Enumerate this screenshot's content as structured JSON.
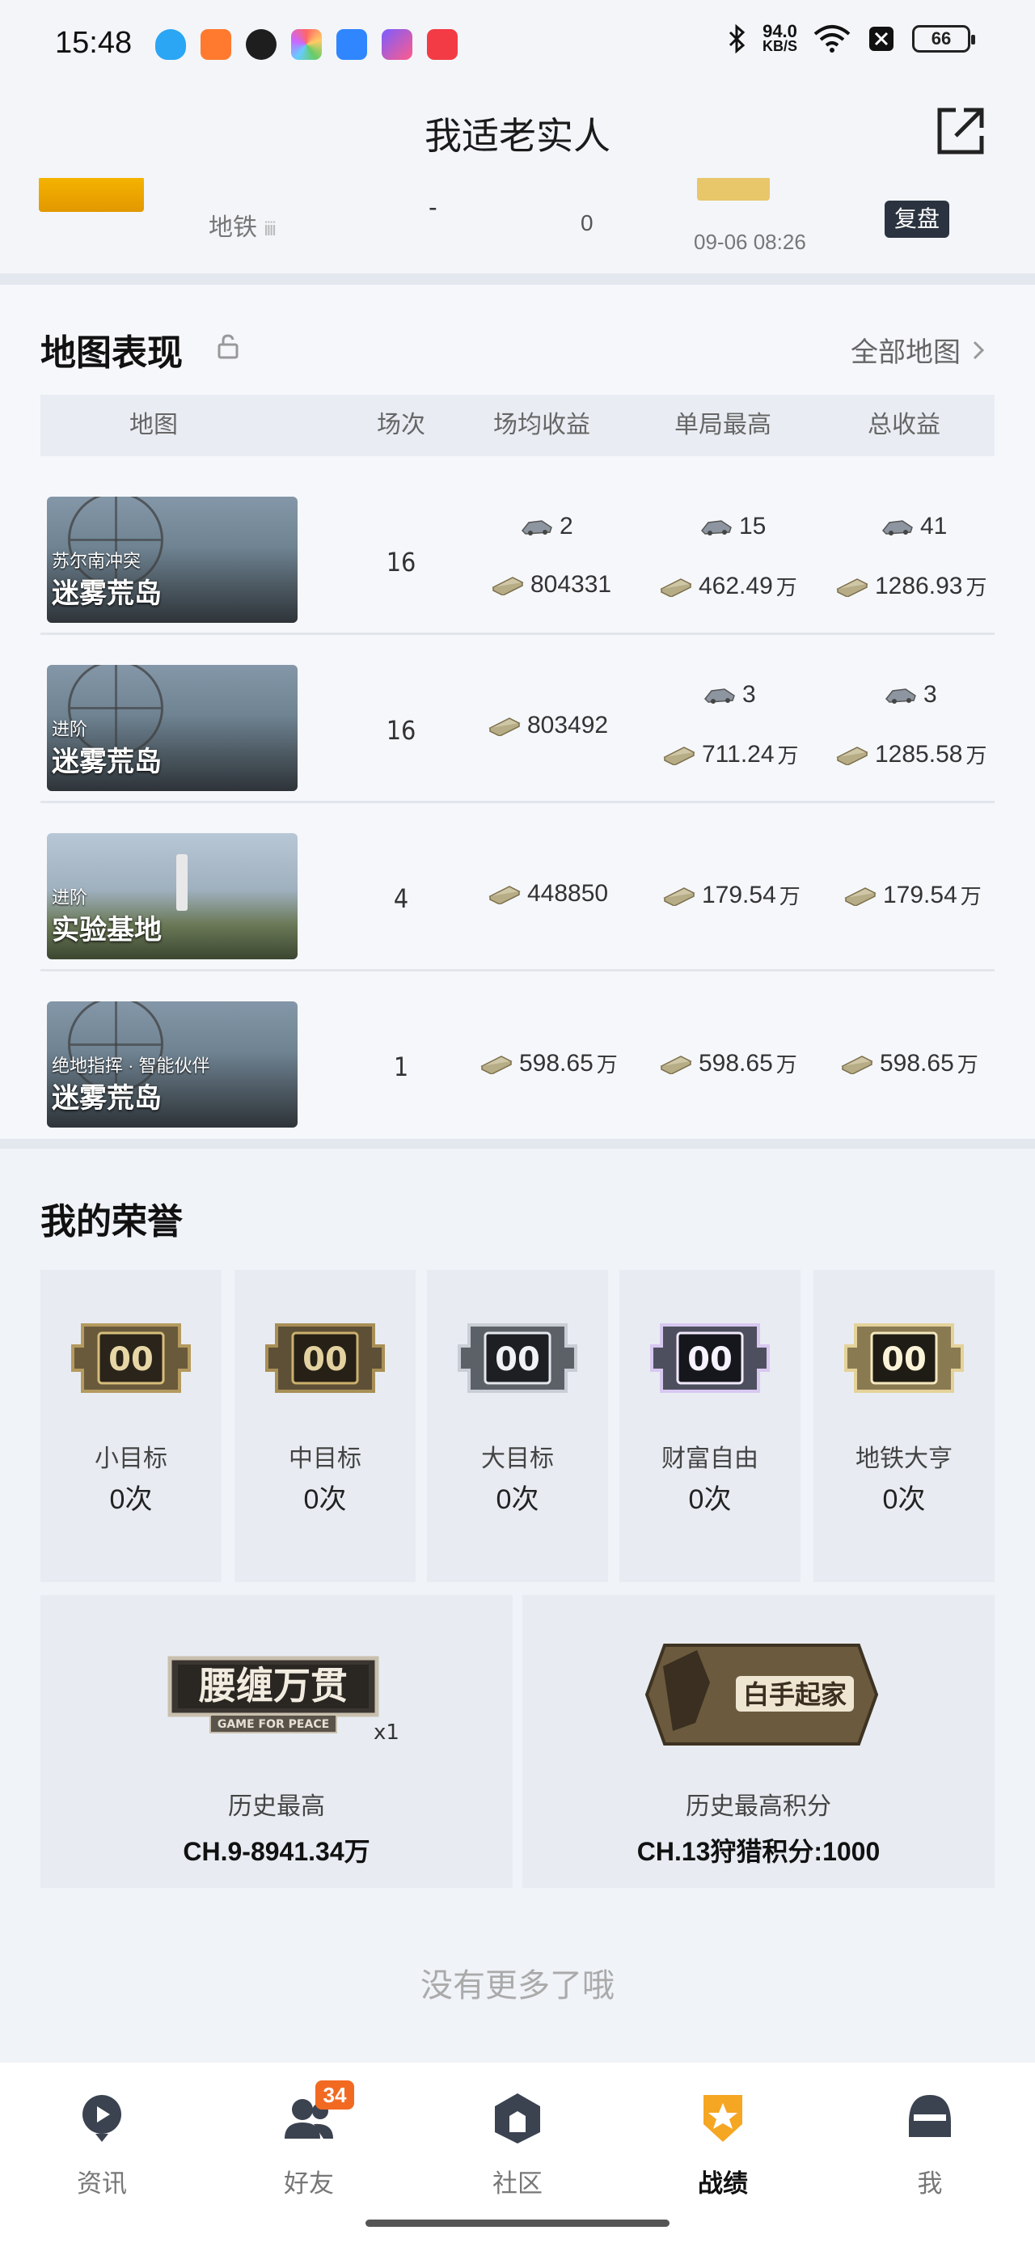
{
  "status_bar": {
    "time": "15:48",
    "net_speed_value": "94.0",
    "net_speed_unit": "KB/S",
    "battery": "66"
  },
  "header": {
    "title": "我适老实人"
  },
  "prev_record": {
    "map": "地铁",
    "dash": "-",
    "value": "0",
    "time": "09-06 08:26",
    "replay_label": "复盘"
  },
  "map_section": {
    "title": "地图表现",
    "all_maps_label": "全部地图",
    "columns": [
      "地图",
      "场次",
      "场均收益",
      "单局最高",
      "总收益"
    ],
    "rows": [
      {
        "mode": "苏尔南冲突",
        "map": "迷雾荒岛",
        "games": "16",
        "avg": {
          "vehicle": "2",
          "money": "804331",
          "unit": ""
        },
        "best": {
          "vehicle": "15",
          "money": "462.49",
          "unit": "万"
        },
        "total": {
          "vehicle": "41",
          "money": "1286.93",
          "unit": "万"
        }
      },
      {
        "mode": "进阶",
        "map": "迷雾荒岛",
        "games": "16",
        "avg": {
          "money": "803492",
          "unit": ""
        },
        "best": {
          "vehicle": "3",
          "money": "711.24",
          "unit": "万"
        },
        "total": {
          "vehicle": "3",
          "money": "1285.58",
          "unit": "万"
        }
      },
      {
        "mode": "进阶",
        "map": "实验基地",
        "games": "4",
        "avg": {
          "money": "448850",
          "unit": ""
        },
        "best": {
          "money": "179.54",
          "unit": "万"
        },
        "total": {
          "money": "179.54",
          "unit": "万"
        }
      },
      {
        "mode": "绝地指挥 · 智能伙伴",
        "map": "迷雾荒岛",
        "games": "1",
        "avg": {
          "money": "598.65",
          "unit": "万"
        },
        "best": {
          "money": "598.65",
          "unit": "万"
        },
        "total": {
          "money": "598.65",
          "unit": "万"
        }
      }
    ]
  },
  "honor_section": {
    "title": "我的荣誉",
    "badges": [
      {
        "name": "小目标",
        "count": "0次",
        "badge_text": "00",
        "tier": "bronze"
      },
      {
        "name": "中目标",
        "count": "0次",
        "badge_text": "00",
        "tier": "bronze"
      },
      {
        "name": "大目标",
        "count": "0次",
        "badge_text": "00",
        "tier": "silver"
      },
      {
        "name": "财富自由",
        "count": "0次",
        "badge_text": "00",
        "tier": "holo"
      },
      {
        "name": "地铁大亨",
        "count": "0次",
        "badge_text": "00",
        "tier": "gold"
      }
    ],
    "records": [
      {
        "plaque_text": "腰缠万贯",
        "plaque_sub": "GAME FOR PEACE",
        "multiplier": "x1",
        "label": "历史最高",
        "value": "CH.9-8941.34万"
      },
      {
        "plaque_text": "白手起家",
        "label": "历史最高积分",
        "value": "CH.13狩猎积分:1000"
      }
    ],
    "end_text": "没有更多了哦"
  },
  "bottom_nav": {
    "items": [
      {
        "label": "资讯",
        "icon": "news-icon"
      },
      {
        "label": "好友",
        "icon": "friends-icon",
        "badge": "34"
      },
      {
        "label": "社区",
        "icon": "community-icon"
      },
      {
        "label": "战绩",
        "icon": "record-icon",
        "active": true
      },
      {
        "label": "我",
        "icon": "profile-icon"
      }
    ]
  },
  "colors": {
    "accent": "#f5a623",
    "nav_badge": "#f26a21",
    "replay_btn": "#2b3340"
  }
}
